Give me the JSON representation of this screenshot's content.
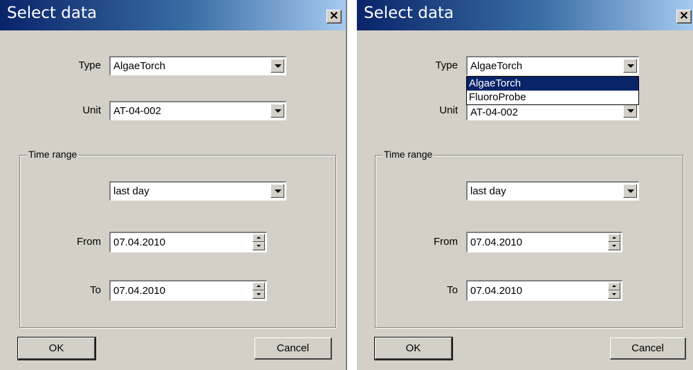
{
  "dialogs": [
    {
      "title": "Select data",
      "close_glyph": "✕",
      "type_label": "Type",
      "type_value": "AlgaeTorch",
      "unit_label": "Unit",
      "unit_value": "AT-04-002",
      "time_range_label": "Time range",
      "range_value": "last day",
      "from_label": "From",
      "from_value": "07.04.2010",
      "to_label": "To",
      "to_value": "07.04.2010",
      "ok_label": "OK",
      "cancel_label": "Cancel"
    },
    {
      "title": "Select data",
      "close_glyph": "✕",
      "type_label": "Type",
      "type_value": "AlgaeTorch",
      "type_options": [
        "AlgaeTorch",
        "FluoroProbe"
      ],
      "type_selected_index": 0,
      "unit_label": "Unit",
      "unit_value": "AT-04-002",
      "time_range_label": "Time range",
      "range_value": "last day",
      "from_label": "From",
      "from_value": "07.04.2010",
      "to_label": "To",
      "to_value": "07.04.2010",
      "ok_label": "OK",
      "cancel_label": "Cancel"
    }
  ],
  "colors": {
    "dialog_face": "#d4d0c8",
    "title_active": "#0a246a",
    "selection": "#0a246a"
  }
}
